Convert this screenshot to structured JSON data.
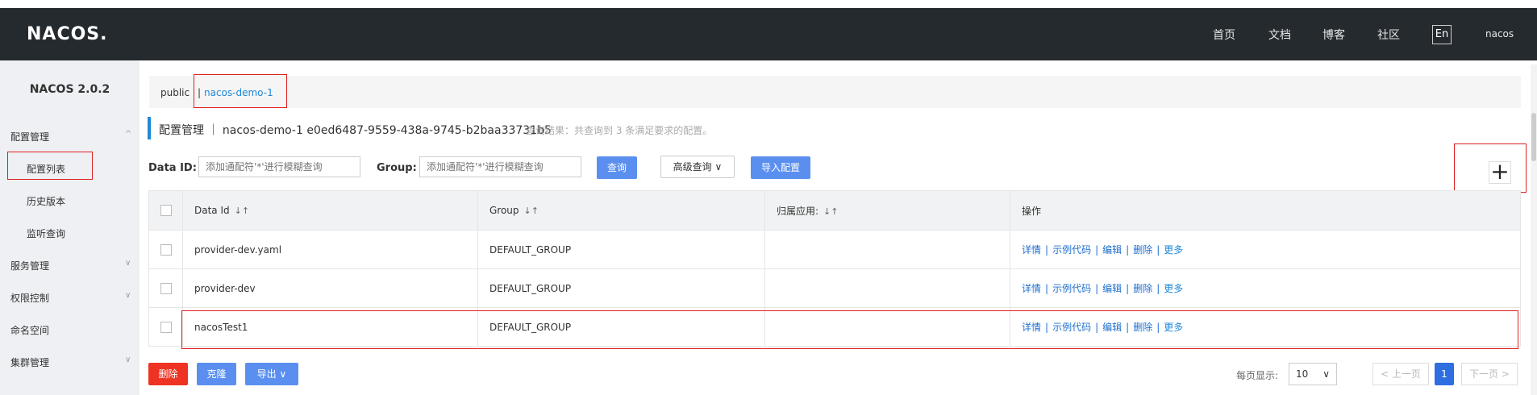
{
  "header": {
    "logo": "NACOS.",
    "nav": [
      "首页",
      "文档",
      "博客",
      "社区"
    ],
    "lang": "En",
    "user": "nacos"
  },
  "sidebar": {
    "version": "NACOS 2.0.2",
    "items": [
      {
        "label": "配置管理",
        "chevron": "^"
      },
      {
        "label": "配置列表"
      },
      {
        "label": "历史版本"
      },
      {
        "label": "监听查询"
      },
      {
        "label": "服务管理",
        "chevron": "∨"
      },
      {
        "label": "权限控制",
        "chevron": "∨"
      },
      {
        "label": "命名空间"
      },
      {
        "label": "集群管理",
        "chevron": "∨"
      }
    ]
  },
  "namespace": {
    "public": "public",
    "separator": "|",
    "active": "nacos-demo-1"
  },
  "page": {
    "title": "配置管理 ｜ nacos-demo-1  e0ed6487-9559-438a-9745-b2baa33731b5",
    "hint": "查询结果：共查询到 3 条满足要求的配置。"
  },
  "search": {
    "dataid_label": "Data ID:",
    "dataid_placeholder": "添加通配符'*'进行模糊查询",
    "group_label": "Group:",
    "group_placeholder": "添加通配符'*'进行模糊查询",
    "query_label": "查询",
    "advanced_label": "高级查询",
    "import_label": "导入配置",
    "add_label": "+"
  },
  "table": {
    "headers": [
      "Data Id",
      "Group",
      "归属应用:",
      "操作"
    ],
    "rows": [
      {
        "dataid": "provider-dev.yaml",
        "group": "DEFAULT_GROUP",
        "app": ""
      },
      {
        "dataid": "provider-dev",
        "group": "DEFAULT_GROUP",
        "app": ""
      },
      {
        "dataid": "nacosTest1",
        "group": "DEFAULT_GROUP",
        "app": ""
      }
    ],
    "ops": {
      "detail": "详情",
      "sample": "示例代码",
      "edit": "编辑",
      "delete": "删除",
      "more": "更多",
      "sep": "|"
    }
  },
  "footer": {
    "delete_label": "删除",
    "clone_label": "克隆",
    "export_label": "导出",
    "page_size_label": "每页显示:",
    "page_size": "10",
    "prev_label": "< 上一页",
    "current_page": "1",
    "next_label": "下一页 >"
  }
}
